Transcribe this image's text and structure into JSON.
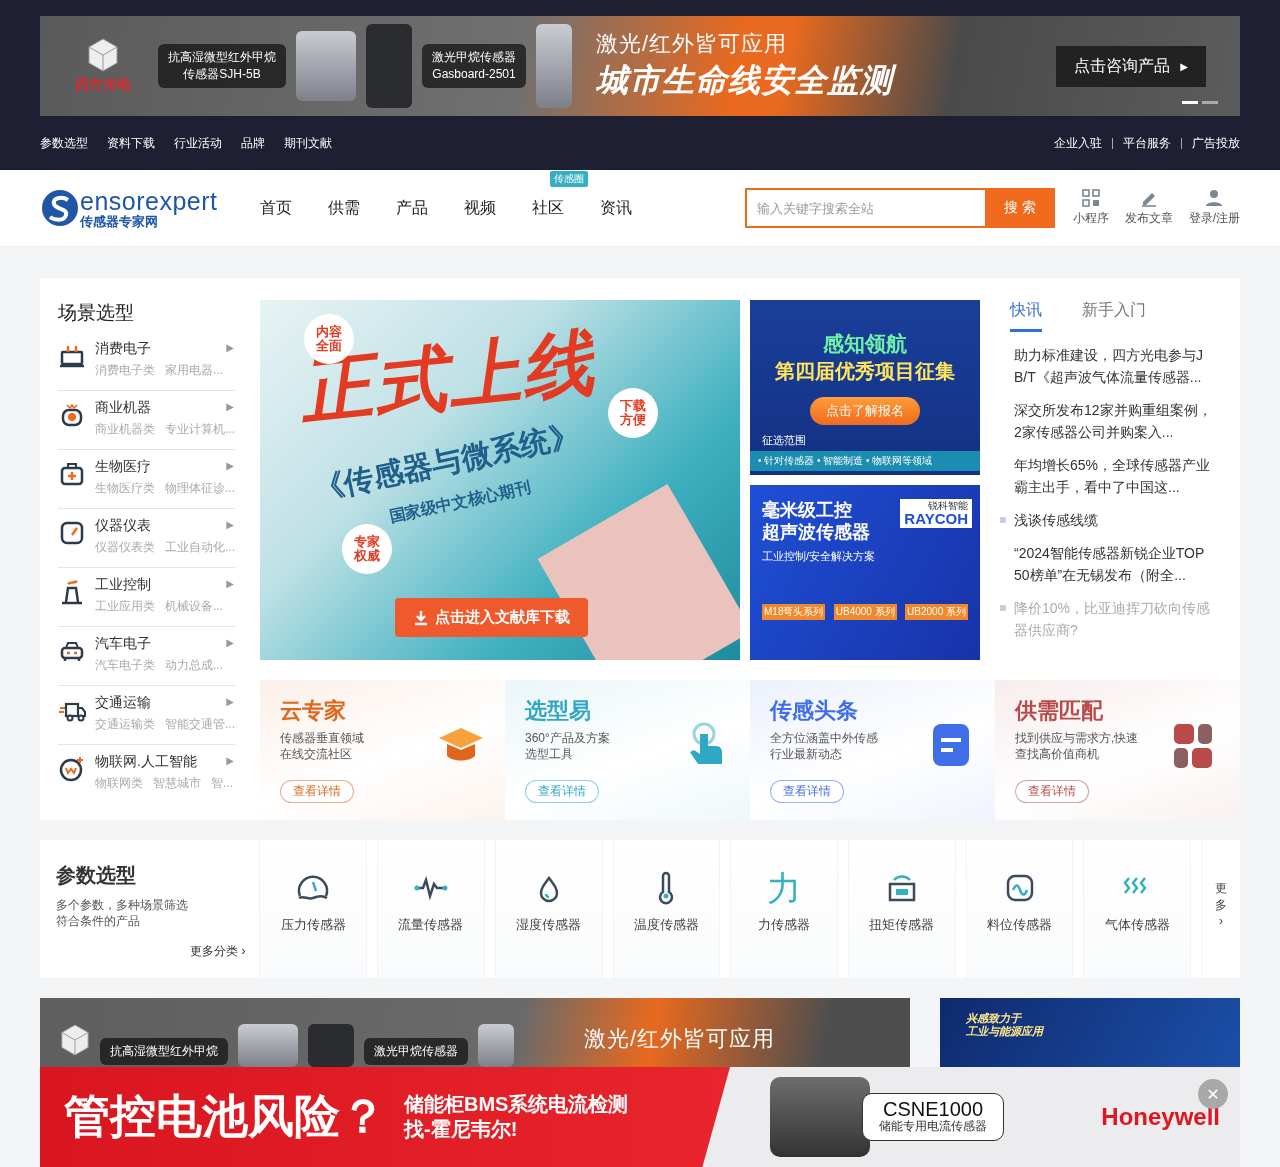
{
  "top_banner": {
    "brand": "四方光电",
    "product_1_lines": [
      "抗高湿微型红外甲烷",
      "传感器SJH-5B"
    ],
    "product_2_lines": [
      "激光甲烷传感器",
      "Gasboard-2501"
    ],
    "headline": "激光/红外皆可应用",
    "subline": "城市生命线安全监测",
    "cta": "点击咨询产品",
    "cta_arrow": "▶",
    "dots": [
      {
        "selected": true
      },
      {
        "selected": false
      }
    ]
  },
  "top_links_left": [
    "参数选型",
    "资料下载",
    "行业活动",
    "品牌",
    "期刊文献"
  ],
  "top_links_right": [
    "企业入驻",
    "平台服务",
    "广告投放"
  ],
  "header": {
    "logo_word": "ensorexpert",
    "logo_sub": "传感器专家网",
    "nav": [
      {
        "label": "首页"
      },
      {
        "label": "供需"
      },
      {
        "label": "产品"
      },
      {
        "label": "视频"
      },
      {
        "label": "社区",
        "badge": "传感圈"
      },
      {
        "label": "资讯"
      }
    ],
    "search": {
      "placeholder": "输入关键字搜索全站",
      "button": "搜 索"
    },
    "tools": [
      {
        "kind": "qr",
        "label": "小程序"
      },
      {
        "kind": "pen",
        "label": "发布文章"
      },
      {
        "kind": "user",
        "label": "登录/注册"
      }
    ]
  },
  "scenes": {
    "title": "场景选型",
    "items": [
      {
        "kind": "plug",
        "title": "消费电子",
        "tags": [
          "消费电子类",
          "家用电器..."
        ],
        "arrow": "▶"
      },
      {
        "kind": "robot",
        "title": "商业机器",
        "tags": [
          "商业机器类",
          "专业计算机..."
        ],
        "arrow": "▶"
      },
      {
        "kind": "medkit",
        "title": "生物医疗",
        "tags": [
          "生物医疗类",
          "物理体征诊..."
        ],
        "arrow": "▶"
      },
      {
        "kind": "gauge",
        "title": "仪器仪表",
        "tags": [
          "仪器仪表类",
          "工业自动化..."
        ],
        "arrow": "▶"
      },
      {
        "kind": "factory",
        "title": "工业控制",
        "tags": [
          "工业应用类",
          "机械设备..."
        ],
        "arrow": "▶"
      },
      {
        "kind": "car",
        "title": "汽车电子",
        "tags": [
          "汽车电子类",
          "动力总成..."
        ],
        "arrow": "▶"
      },
      {
        "kind": "truck",
        "title": "交通运输",
        "tags": [
          "交通运输类",
          "智能交通管..."
        ],
        "arrow": "▶"
      },
      {
        "kind": "ai",
        "title": "物联网.人工智能",
        "tags": [
          "物联网类",
          "智慧城市",
          "智..."
        ],
        "arrow": "▶"
      }
    ]
  },
  "feature": {
    "headline": "正式上线",
    "journal": "《传感器与微系统》",
    "subtitle": "国家级中文核心期刊",
    "badges": [
      "内容全面",
      "下载方便",
      "专家权威"
    ],
    "button": "点击进入文献库下载"
  },
  "ad_1": {
    "title": "感知领航",
    "subtitle": "第四届优秀项目征集",
    "button": "点击了解报名",
    "scope_label": "征选范围",
    "scope": "• 针对传感器 • 智能制造 • 物联网等领域"
  },
  "ad_2": {
    "title_lines": [
      "毫米级工控",
      "超声波传感器"
    ],
    "subtitle": "工业控制/安全解决方案",
    "brand_cn": "锐科智能",
    "brand": "RAYCOH",
    "series": [
      "M18弯头系列",
      "UB4000 系列",
      "UB2000 系列"
    ]
  },
  "news": {
    "tabs": [
      {
        "label": "快讯",
        "selected": true
      },
      {
        "label": "新手入门",
        "selected": false
      }
    ],
    "items": [
      {
        "text": "助力标准建设，四方光电参与JB/T《超声波气体流量传感器...",
        "marked": false,
        "faded": false
      },
      {
        "text": "深交所发布12家并购重组案例，2家传感器公司并购案入...",
        "marked": false,
        "faded": false
      },
      {
        "text": "年均增长65%，全球传感器产业霸主出手，看中了中国这...",
        "marked": false,
        "faded": false
      },
      {
        "text": "浅谈传感线缆",
        "marked": true,
        "faded": false
      },
      {
        "text": "“2024智能传感器新锐企业TOP50榜单”在无锡发布（附全...",
        "marked": false,
        "faded": false
      },
      {
        "text": "降价10%，比亚迪挥刀砍向传感器供应商?",
        "marked": true,
        "faded": true
      }
    ]
  },
  "services": [
    {
      "kind": "cap",
      "title": "云专家",
      "lines": [
        "传感器垂直领域",
        "在线交流社区"
      ],
      "button": "查看详情",
      "color": "#e0661c"
    },
    {
      "kind": "hand",
      "title": "选型易",
      "lines": [
        "360°产品及方案",
        "选型工具"
      ],
      "button": "查看详情",
      "color": "#2fa7c5"
    },
    {
      "kind": "doc",
      "title": "传感头条",
      "lines": [
        "全方位涵盖中外传感",
        "行业最新动态"
      ],
      "button": "查看详情",
      "color": "#3f6ee8"
    },
    {
      "kind": "grid",
      "title": "供需匹配",
      "lines": [
        "找到供应与需求方,快速",
        "查找高价值商机"
      ],
      "button": "查看详情",
      "color": "#b84a4a"
    }
  ],
  "params": {
    "title": "参数选型",
    "lines": [
      "多个参数，多种场景筛选",
      "符合条件的产品"
    ],
    "more": "更多分类",
    "more_arrow": "›",
    "items": [
      {
        "kind": "pressure",
        "label": "压力传感器"
      },
      {
        "kind": "flow",
        "label": "流量传感器"
      },
      {
        "kind": "humidity",
        "label": "湿度传感器"
      },
      {
        "kind": "temperature",
        "label": "温度传感器"
      },
      {
        "kind": "glyph",
        "glyph": "力",
        "label": "力传感器"
      },
      {
        "kind": "torque",
        "label": "扭矩传感器"
      },
      {
        "kind": "level",
        "label": "料位传感器"
      },
      {
        "kind": "gas",
        "label": "气体传感器"
      }
    ],
    "next": "更多",
    "next_arrow": "›"
  },
  "bottom_banner": {
    "product_1": "抗高湿微型红外甲烷",
    "product_2": "激光甲烷传感器",
    "headline": "激光/红外皆可应用"
  },
  "side_banner": {
    "lines": [
      "兴感致力于",
      "工业与能源应用"
    ]
  },
  "float_ad": {
    "headline": "管控电池风险？",
    "lines": [
      "储能柜BMS系统电流检测",
      "找-霍尼韦尔!"
    ],
    "model": "CSNE1000",
    "model_desc": "储能专用电流传感器",
    "brand": "Honeywell",
    "close": "✕"
  }
}
